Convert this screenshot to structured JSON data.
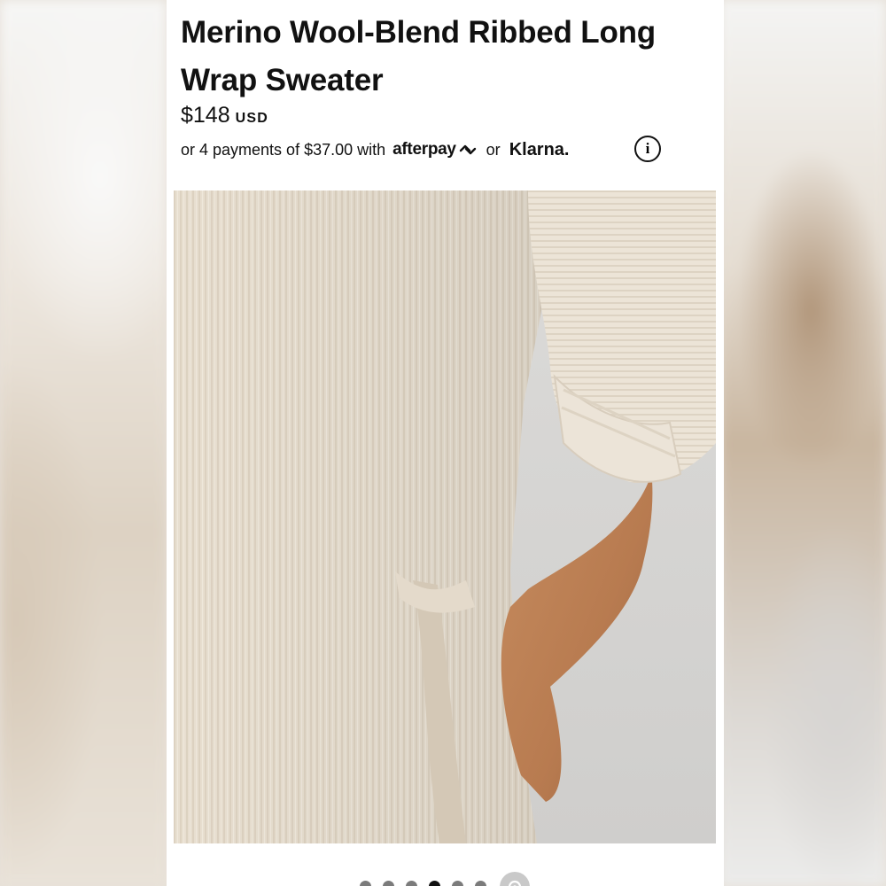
{
  "product": {
    "title": "Merino Wool-Blend Ribbed Long Wrap Sweater",
    "price": {
      "amount": "$148",
      "currency": "USD"
    },
    "installments": {
      "prefix": "or 4 payments of $37.00 with",
      "provider_1": "afterpay",
      "joiner": "or",
      "provider_2": "Klarna."
    },
    "info_icon": "info-circle-icon"
  },
  "gallery": {
    "image": "ribbed-sweater-with-hand-in-pocket",
    "dot_count": 6,
    "active_dot": 3,
    "zoom_icon": "zoom-tag-icon"
  },
  "colors": {
    "sweater": "#e6dccc",
    "skin": "#c48a5e",
    "background_wall": "#d9d8d6",
    "text": "#111111"
  }
}
